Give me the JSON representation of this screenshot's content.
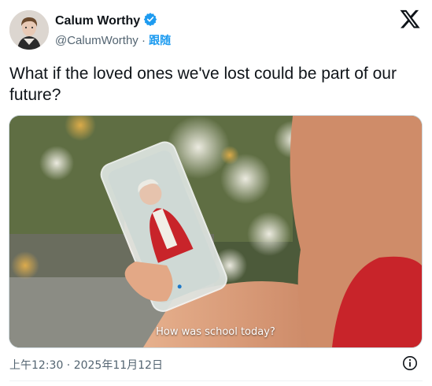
{
  "tweet": {
    "author_name": "Calum Worthy",
    "handle": "@CalumWorthy",
    "separator": "·",
    "follow_label": "跟随",
    "text": "What if the loved ones we've lost could be part of our future?",
    "timestamp": "上午12:30 · 2025年11月12日",
    "verified": true
  },
  "media": {
    "caption": "How was school today?"
  },
  "icons": {
    "verified": "verified-badge-icon",
    "logo": "x-logo-icon",
    "info": "info-icon"
  },
  "colors": {
    "accent": "#1d9bf0",
    "secondary_text": "#536471",
    "video_shirt": "#c8242a"
  }
}
